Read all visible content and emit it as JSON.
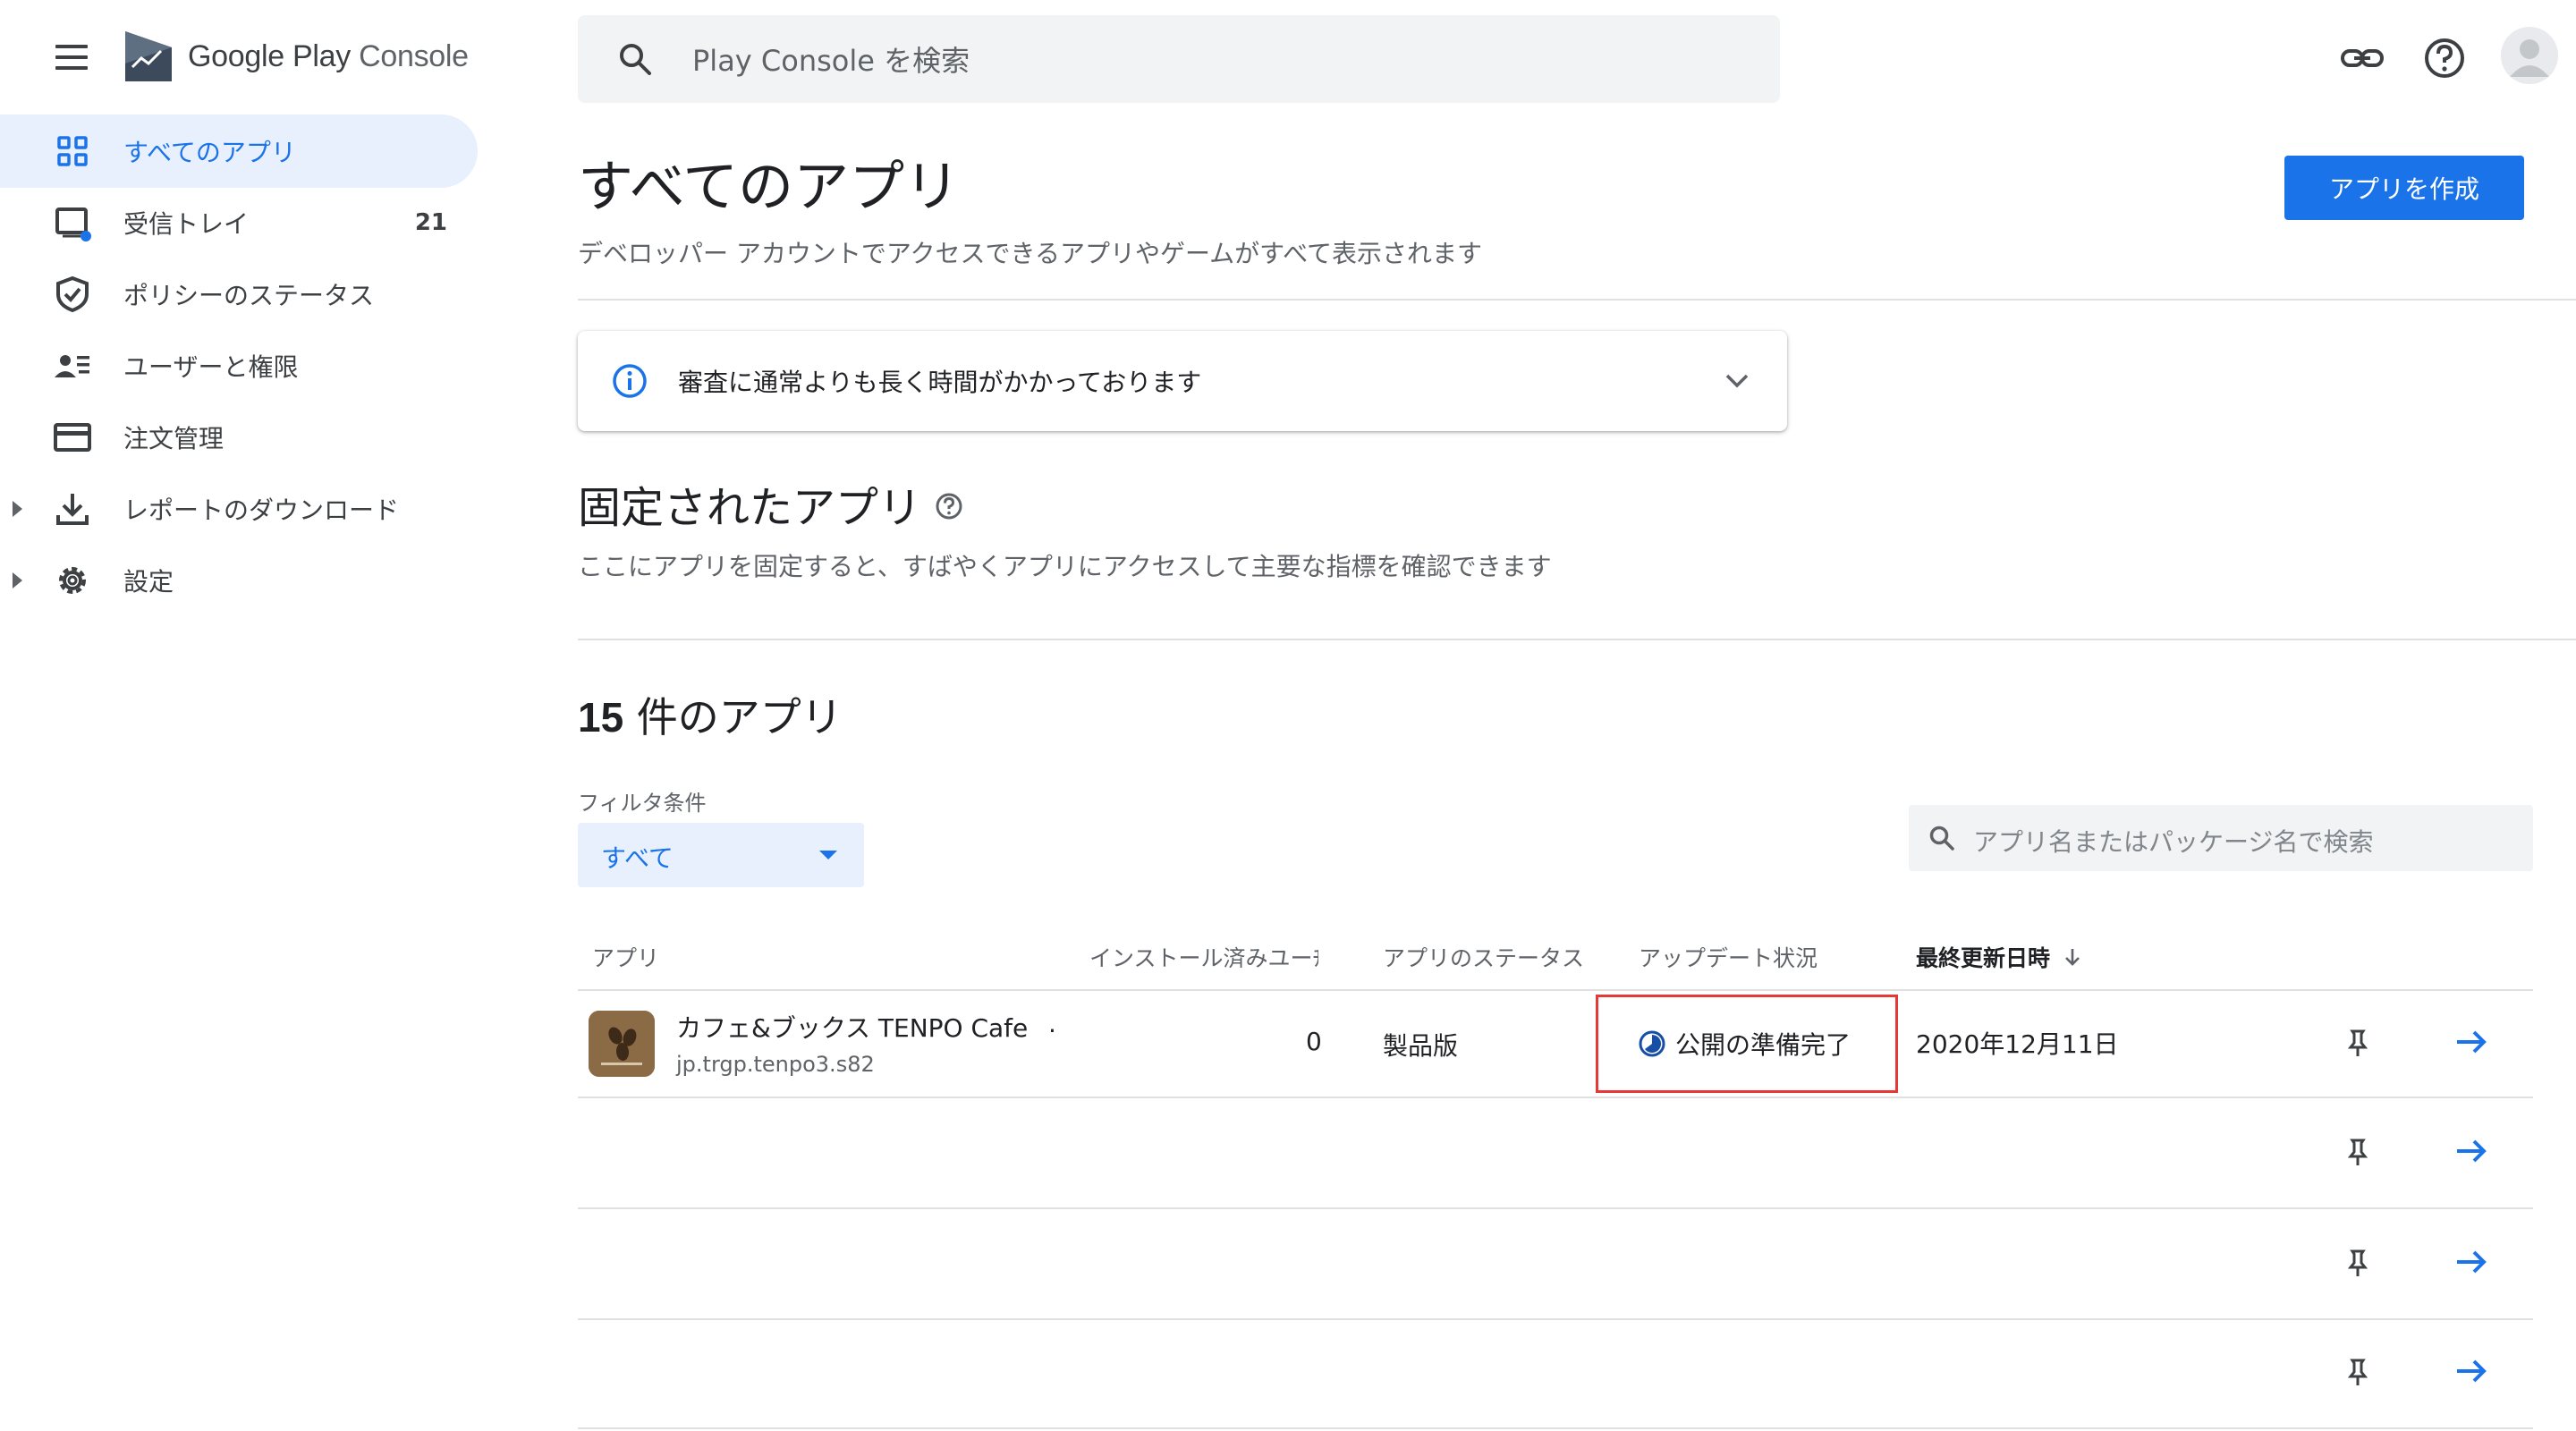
{
  "header": {
    "logo_text_main": "Google Play",
    "logo_text_sub": "Console",
    "search_placeholder": "Play Console を検索"
  },
  "nav": {
    "items": [
      {
        "label": "すべてのアプリ",
        "icon": "grid-icon"
      },
      {
        "label": "受信トレイ",
        "icon": "inbox-icon",
        "count": "21"
      },
      {
        "label": "ポリシーのステータス",
        "icon": "shield-icon"
      },
      {
        "label": "ユーザーと権限",
        "icon": "users-icon"
      },
      {
        "label": "注文管理",
        "icon": "credit-card-icon"
      },
      {
        "label": "レポートのダウンロード",
        "icon": "download-icon"
      },
      {
        "label": "設定",
        "icon": "gear-icon"
      }
    ]
  },
  "main": {
    "title": "すべてのアプリ",
    "subtitle": "デベロッパー アカウントでアクセスできるアプリやゲームがすべて表示されます",
    "create_button": "アプリを作成",
    "notice": "審査に通常よりも長く時間がかかっております",
    "pinned_title": "固定されたアプリ",
    "pinned_subtitle": "ここにアプリを固定すると、すばやくアプリにアクセスして主要な指標を確認できます",
    "count_number": "15",
    "count_suffix": " 件のアプリ",
    "filter_label": "フィルタ条件",
    "filter_value": "すべて",
    "app_search_placeholder": "アプリ名またはパッケージ名で検索"
  },
  "table": {
    "headers": {
      "app": "アプリ",
      "installs": "インストール済みユーﾁ",
      "status": "アプリのステータス",
      "update": "アップデート状況",
      "last_updated": "最終更新日時"
    },
    "rows": [
      {
        "name": "カフェ&ブックス TENPO Cafe",
        "name_extra": ".",
        "package": "jp.trgp.tenpo3.s82",
        "installs": "0",
        "status": "製品版",
        "update": "公開の準備完了",
        "last_updated": "2020年12月11日"
      }
    ]
  },
  "colors": {
    "accent": "#1a73e8",
    "nav_active_bg": "#e8f0fe",
    "highlight_border": "#e53935",
    "app_icon_bg": "#8b6a46"
  }
}
